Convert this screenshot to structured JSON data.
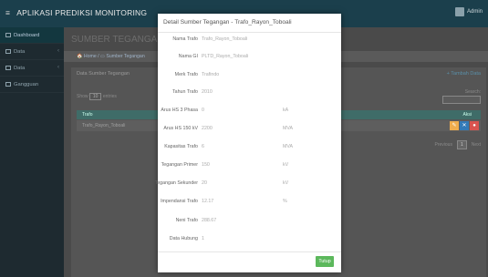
{
  "header": {
    "brand_prefix": "≡",
    "brand": "APLIKASI PREDIKSI MONITORING",
    "user": "Admin"
  },
  "sidebar": {
    "items": [
      {
        "label": "Dashboard"
      },
      {
        "label": "Data",
        "chev": "‹"
      },
      {
        "label": "Data",
        "chev": "‹"
      },
      {
        "label": "Gangguan"
      }
    ]
  },
  "page": {
    "title": "SUMBER TEGANGAN",
    "breadcrumb": "🏠 Home  /  ▭ Sumber Tegangan",
    "card_title": "Data Sumber Tegangan",
    "add_label": "+ Tambah Data",
    "show_prefix": "Show",
    "show_value": "10",
    "show_suffix": "entries",
    "search_label": "Search:",
    "columns": {
      "trafo": "Trafo",
      "aksi": "Aksi"
    },
    "row": {
      "trafo": "Trafo_Rayon_Toboali"
    },
    "pagination": {
      "prev": "Previous",
      "page": "1",
      "next": "Next"
    }
  },
  "modal": {
    "title": "Detail Sumber Tegangan - Trafo_Rayon_Toboali",
    "rows": [
      {
        "label": "Nama Trafo",
        "value": "Trafo_Rayon_Toboali",
        "unit": ""
      },
      {
        "label": "Nama GI",
        "value": "PLTD_Rayon_Toboali",
        "unit": ""
      },
      {
        "label": "Merk Trafo",
        "value": "Trafindo",
        "unit": ""
      },
      {
        "label": "Tahun Trafo",
        "value": "2010",
        "unit": ""
      },
      {
        "label": "Arus HS 3 Phasa",
        "value": "0",
        "unit": "kA"
      },
      {
        "label": "Arus HS 150 kV",
        "value": "2200",
        "unit": "MVA"
      },
      {
        "label": "Kapasitas Trafo",
        "value": "6",
        "unit": "MVA"
      },
      {
        "label": "Tegangan Primer",
        "value": "150",
        "unit": "kV"
      },
      {
        "label": "Tegangan Sekunder",
        "value": "20",
        "unit": "kV"
      },
      {
        "label": "Impendansi Trafo",
        "value": "12.17",
        "unit": "%"
      },
      {
        "label": "Neni Trafo",
        "value": "288.67",
        "unit": ""
      },
      {
        "label": "Data Hubung",
        "value": "1",
        "unit": ""
      }
    ],
    "close_label": "Tutup"
  }
}
